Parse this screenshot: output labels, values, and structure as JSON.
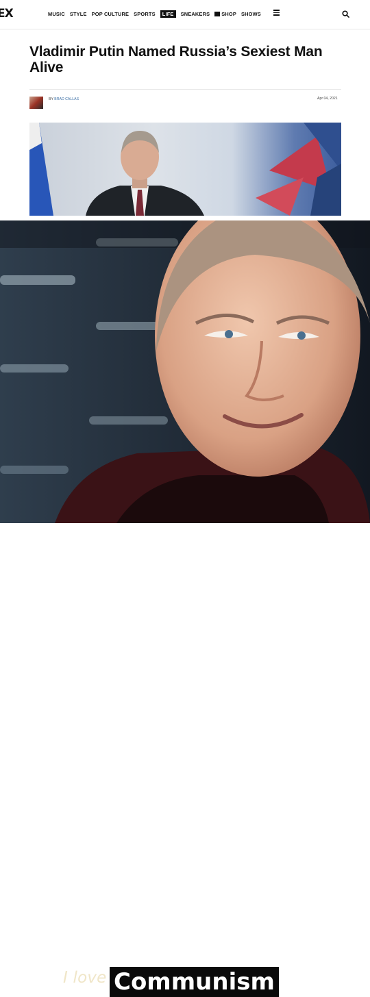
{
  "nav": {
    "logo": "EX",
    "items": [
      "MUSIC",
      "STYLE",
      "POP CULTURE",
      "SPORTS",
      "LIFE",
      "SNEAKERS",
      "SHOP",
      "SHOWS"
    ],
    "active_item": "LIFE"
  },
  "icons": {
    "menu": "hamburger-icon",
    "search": "search-icon",
    "shop": "shop-icon"
  },
  "article": {
    "headline": "Vladimir Putin Named Russia’s Sexiest Man Alive",
    "by_prefix": "BY",
    "author": "BRAD CALLAS",
    "date": "Apr 04, 2021"
  },
  "meme": {
    "caption_italic": "I love",
    "caption_bold": "Communism"
  },
  "colors": {
    "author_link": "#3a6ea5",
    "caption_box": "#0a0a0a"
  }
}
